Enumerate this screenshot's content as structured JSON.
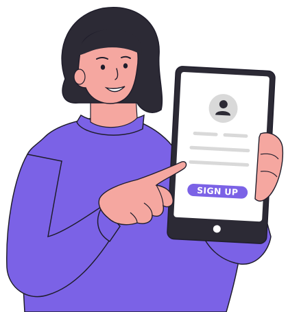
{
  "illustration": {
    "colors": {
      "sweater": "#7B62E6",
      "hair": "#2C2A35",
      "skin": "#F5A7A0",
      "outline": "#1F1D2B",
      "tablet_frame": "#2C2A35",
      "screen": "#FFFFFF",
      "avatar_circle": "#D9D9D9",
      "placeholder_line": "#D9D9D9",
      "button": "#7B62E6",
      "button_text": "#FFFFFF"
    },
    "icons": {
      "avatar": "user-icon",
      "home_button": "home-button-icon"
    }
  },
  "signup_form": {
    "button_label": "SIGN UP"
  }
}
